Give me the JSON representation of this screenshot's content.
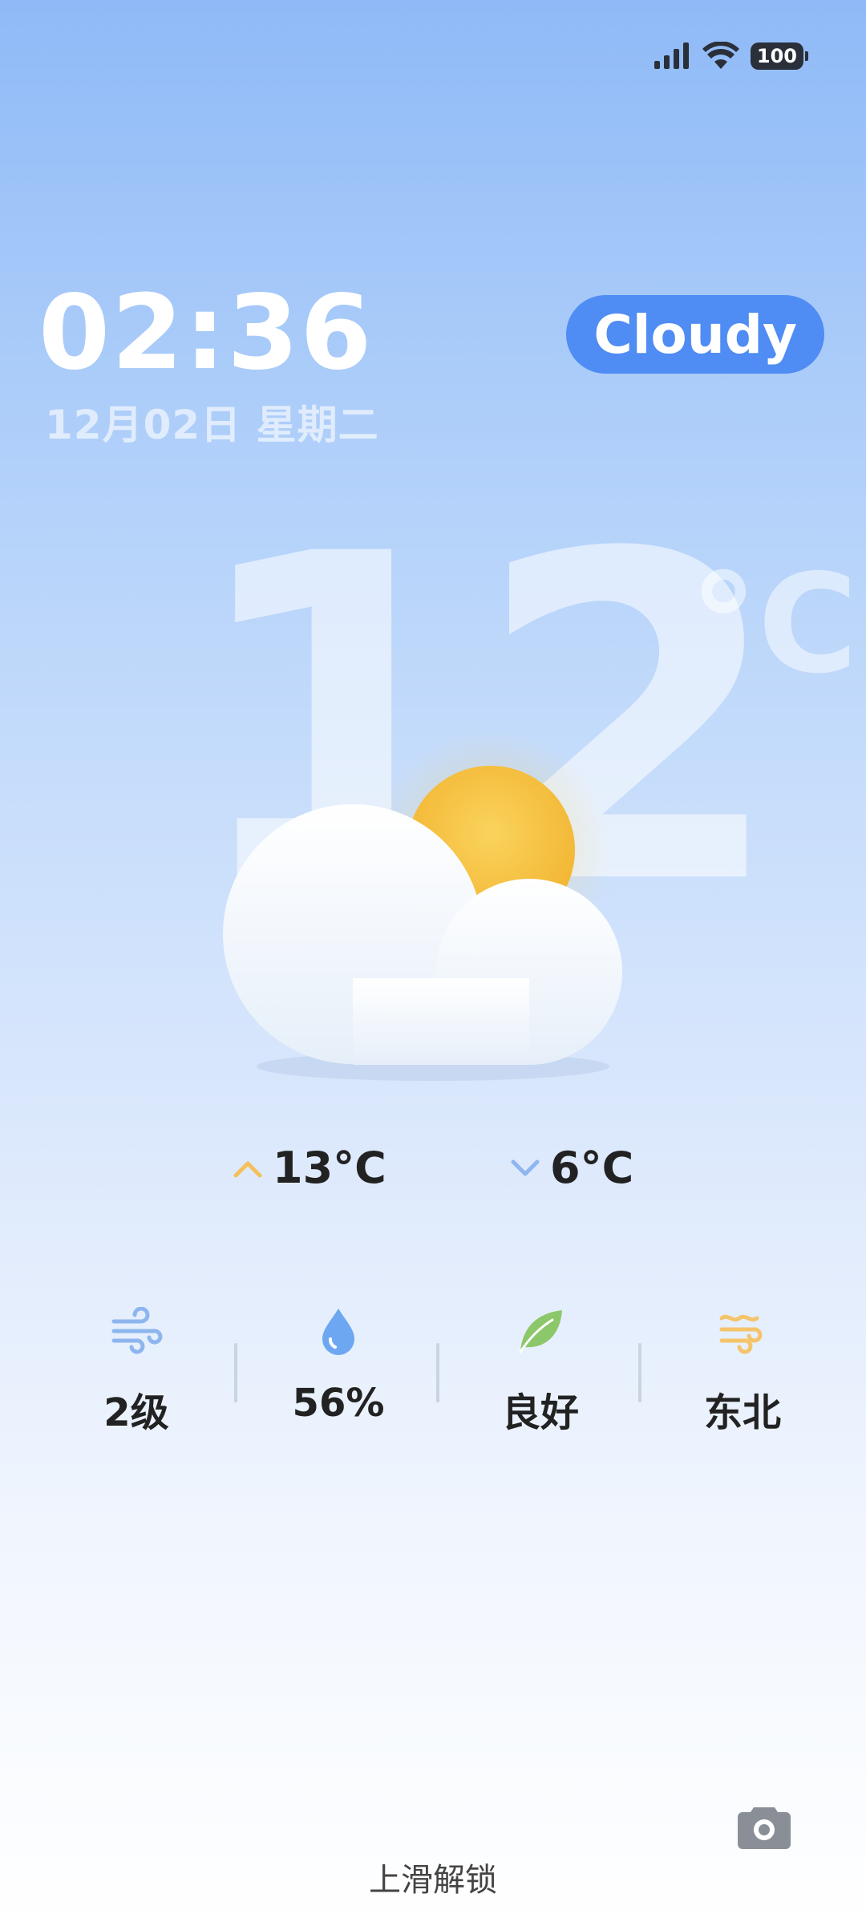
{
  "status_bar": {
    "signal_icon": "cellular-signal-icon",
    "wifi_icon": "wifi-icon",
    "battery_level": "100"
  },
  "lockscreen": {
    "time": "02:36",
    "date": "12月02日 星期二",
    "condition_label": "Cloudy",
    "current_temp": "12",
    "temp_unit": "°C",
    "weather_icon": "partly-cloudy-icon"
  },
  "forecast": {
    "high": "13°C",
    "low": "6°C",
    "high_color": "#f4c05b",
    "low_color": "#8fb6ef"
  },
  "metrics": [
    {
      "icon": "wind-icon",
      "value": "2级"
    },
    {
      "icon": "humidity-drop-icon",
      "value": "56%"
    },
    {
      "icon": "air-quality-leaf-icon",
      "value": "良好"
    },
    {
      "icon": "wind-direction-icon",
      "value": "东北"
    }
  ],
  "footer": {
    "unlock_hint": "上滑解锁",
    "camera_icon": "camera-icon"
  },
  "colors": {
    "accent": "#4f8cf3",
    "sun": "#f6c23f"
  }
}
